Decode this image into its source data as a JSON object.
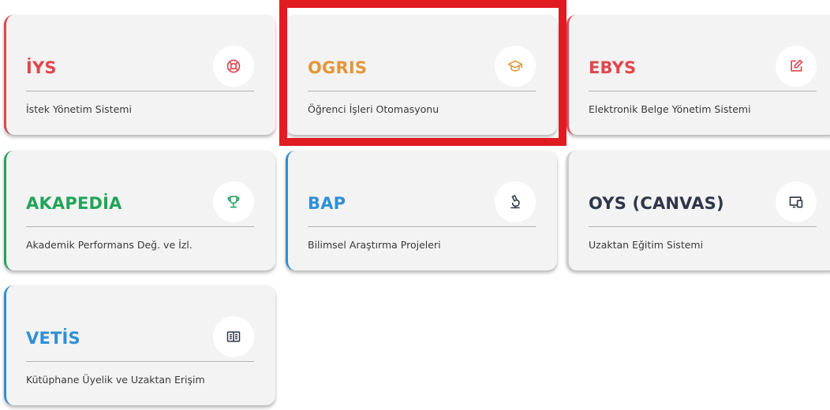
{
  "colors": {
    "card_bg": "#f3f3f3",
    "iys": "#e0474c",
    "ogris": "#e2973a",
    "ebys": "#e0474c",
    "akapedia": "#22a45a",
    "bap": "#2f8fd6",
    "oys": "#2f3648",
    "vetis": "#2f8fd6",
    "highlight": "#e11b22"
  },
  "cards": [
    {
      "title": "İYS",
      "description": "İstek Yönetim Sistemi",
      "icon": "lifebuoy-icon"
    },
    {
      "title": "OGRIS",
      "description": "Öğrenci İşleri Otomasyonu",
      "icon": "graduation-cap-icon"
    },
    {
      "title": "EBYS",
      "description": "Elektronik Belge Yönetim Sistemi",
      "icon": "edit-document-icon"
    },
    {
      "title": "AKAPEDİA",
      "description": "Akademik Performans Değ. ve İzl.",
      "icon": "trophy-icon"
    },
    {
      "title": "BAP",
      "description": "Bilimsel Araştırma Projeleri",
      "icon": "microscope-icon"
    },
    {
      "title": "OYS (CANVAS)",
      "description": "Uzaktan Eğitim Sistemi",
      "icon": "devices-icon"
    },
    {
      "title": "VETİS",
      "description": "Kütüphane Üyelik ve Uzaktan Erişim",
      "icon": "open-book-icon"
    }
  ]
}
